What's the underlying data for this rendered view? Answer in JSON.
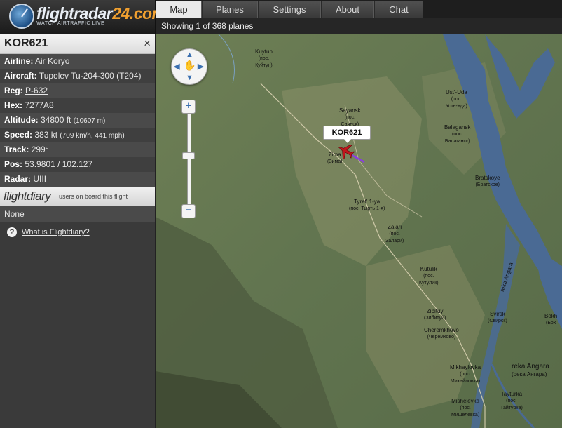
{
  "logo": {
    "text_main": "flightradar",
    "text_accent": "24.com",
    "tagline": "WATCH AIRTRAFFIC LIVE"
  },
  "tabs": [
    {
      "label": "Map",
      "active": true
    },
    {
      "label": "Planes",
      "active": false
    },
    {
      "label": "Settings",
      "active": false
    },
    {
      "label": "About",
      "active": false
    },
    {
      "label": "Chat",
      "active": false
    }
  ],
  "status": {
    "text": "Showing 1 of 368 planes"
  },
  "flight": {
    "callsign": "KOR621",
    "close_icon": "×",
    "airline_label": "Airline:",
    "airline": "Air Koryo",
    "aircraft_label": "Aircraft:",
    "aircraft": "Tupolev Tu-204-300 (T204)",
    "reg_label": "Reg:",
    "reg": "P-632",
    "hex_label": "Hex:",
    "hex": "7277A8",
    "altitude_label": "Altitude:",
    "altitude": "34800 ft",
    "altitude_m": "(10607 m)",
    "speed_label": "Speed:",
    "speed": "383 kt",
    "speed_alt": "(709 km/h, 441 mph)",
    "track_label": "Track:",
    "track": "299°",
    "pos_label": "Pos:",
    "pos": "53.9801 / 102.127",
    "radar_label": "Radar:",
    "radar": "UIII"
  },
  "flightdiary": {
    "logo": "flightdiary",
    "text": "users on board this flight",
    "none": "None",
    "help_icon": "?",
    "help_link": "What is Flightdiary?"
  },
  "map": {
    "plane_label": "KOR621",
    "towns": [
      {
        "name": "Kuytun",
        "ru": "(пос.",
        "ru2": "Куйтун)"
      },
      {
        "name": "Sayansk",
        "ru": "(пос.",
        "ru2": "Саянск)"
      },
      {
        "name": "Zima",
        "ru": "(Зима)",
        "ru2": ""
      },
      {
        "name": "Ust'-Uda",
        "ru": "(пос.",
        "ru2": "Усть-Уда)"
      },
      {
        "name": "Balagansk",
        "ru": "(пос.",
        "ru2": "Балаганск)"
      },
      {
        "name": "Bratskoye",
        "ru": "(Братское)",
        "ru2": ""
      },
      {
        "name": "Tyret' 1-ya",
        "ru": "(пос. Тырть 1-я)",
        "ru2": ""
      },
      {
        "name": "Zalari",
        "ru": "(пос.",
        "ru2": "Залари)"
      },
      {
        "name": "Kutulik",
        "ru": "(пос.",
        "ru2": "Кутулик)"
      },
      {
        "name": "Zibituy",
        "ru": "(Зибитуй)",
        "ru2": ""
      },
      {
        "name": "Cheremkhovo",
        "ru": "(Черемхово)",
        "ru2": ""
      },
      {
        "name": "Svirsk",
        "ru": "(Свирск)",
        "ru2": ""
      },
      {
        "name": "Mikhaylovka",
        "ru": "(пос.",
        "ru2": "Михайловка)"
      },
      {
        "name": "Tayturka",
        "ru": "(пос.",
        "ru2": "Тайтурка)"
      },
      {
        "name": "Mishelevka",
        "ru": "(пос.",
        "ru2": "Мишелевка)"
      },
      {
        "name": "Bokh",
        "ru": "(Бох",
        "ru2": ""
      }
    ],
    "rivers": [
      {
        "name": "reka Angara"
      },
      {
        "name": "(река Ангара)"
      },
      {
        "name": "reka Angara"
      }
    ]
  }
}
